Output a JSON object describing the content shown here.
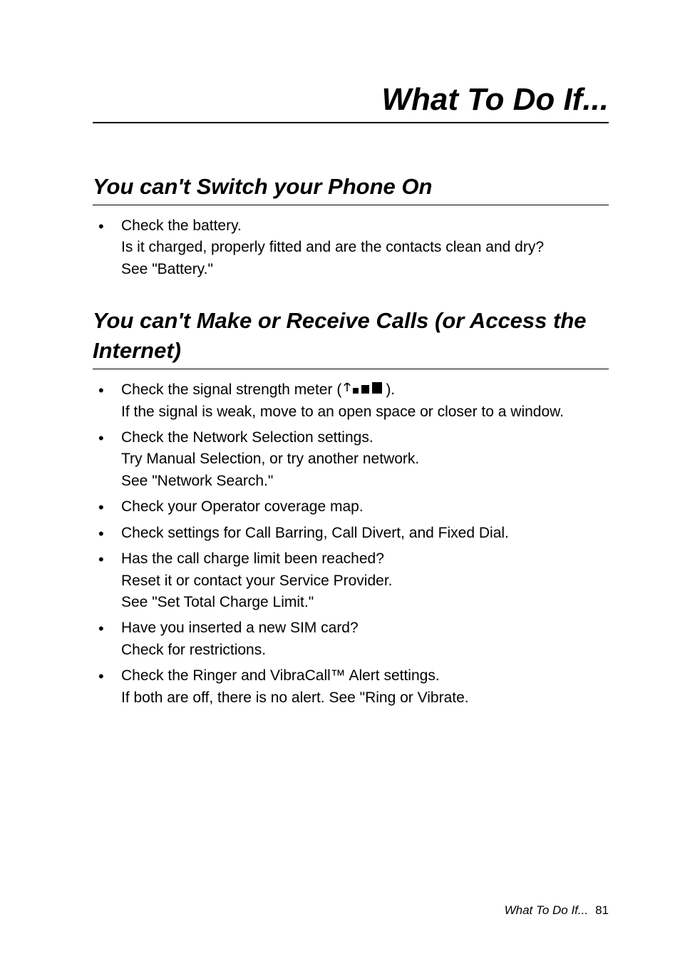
{
  "page_title": "What To Do If...",
  "sections": [
    {
      "heading": "You can't Switch your Phone On",
      "items": [
        {
          "lines": [
            "Check the battery.",
            "Is it charged, properly fitted and are the contacts clean and dry?",
            "See \"Battery.\""
          ]
        }
      ]
    },
    {
      "heading": "You can't Make or Receive Calls (or Access the Internet)",
      "items": [
        {
          "lines_with_icon": {
            "pre": "Check the signal strength meter (",
            "post": ")."
          },
          "lines": [
            "If the signal is weak, move to an open space or closer to a window."
          ]
        },
        {
          "lines": [
            "Check the Network Selection settings.",
            "Try Manual Selection, or try another network.",
            "See \"Network Search.\""
          ]
        },
        {
          "lines": [
            "Check your Operator coverage map."
          ]
        },
        {
          "lines": [
            "Check settings for Call Barring, Call Divert, and Fixed Dial."
          ]
        },
        {
          "lines": [
            "Has the call charge limit been reached?",
            "Reset it or contact your Service Provider.",
            "See \"Set Total Charge Limit.\""
          ]
        },
        {
          "lines": [
            "Have you inserted a new SIM card?",
            "Check for restrictions."
          ]
        },
        {
          "lines": [
            "Check the Ringer and VibraCall™ Alert settings.",
            "If both are off, there is no alert. See \"Ring or Vibrate."
          ]
        }
      ]
    }
  ],
  "footer": {
    "label": "What To Do If...",
    "page_number": "81"
  }
}
